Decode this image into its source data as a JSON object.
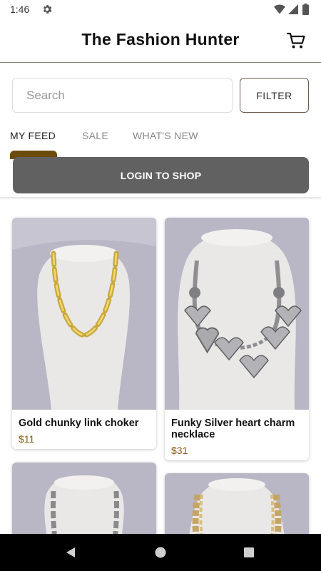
{
  "status_bar": {
    "time": "1:46",
    "icons": [
      "settings-gear-icon",
      "wifi-icon",
      "signal-icon",
      "battery-icon"
    ]
  },
  "header": {
    "title": "The Fashion Hunter",
    "cart_icon": "cart-icon"
  },
  "search": {
    "placeholder": "Search",
    "value": "",
    "filter_label": "FILTER"
  },
  "tabs": [
    {
      "label": "MY FEED",
      "active": true
    },
    {
      "label": "SALE",
      "active": false
    },
    {
      "label": "WHAT'S NEW",
      "active": false
    }
  ],
  "login_banner": {
    "label": "LOGIN TO SHOP"
  },
  "products": [
    {
      "name": "Gold chunky link choker",
      "price": "$11",
      "image": "gold-chain-necklace-on-bust"
    },
    {
      "name": "Funky Silver heart charm necklace",
      "price": "$31",
      "image": "silver-heart-charm-necklace-on-bust"
    },
    {
      "name": "",
      "price": "",
      "image": "silver-chain-necklace-on-bust"
    },
    {
      "name": "",
      "price": "",
      "image": "gold-layered-chain-necklace-on-bust"
    }
  ],
  "nav_bar": {
    "icons": [
      "back-icon",
      "home-icon",
      "recents-icon"
    ]
  },
  "colors": {
    "accent_brown": "#6b4c0c",
    "price_brown": "#8a5a10",
    "login_gray": "#616161",
    "filter_border": "#6e5a4e"
  }
}
